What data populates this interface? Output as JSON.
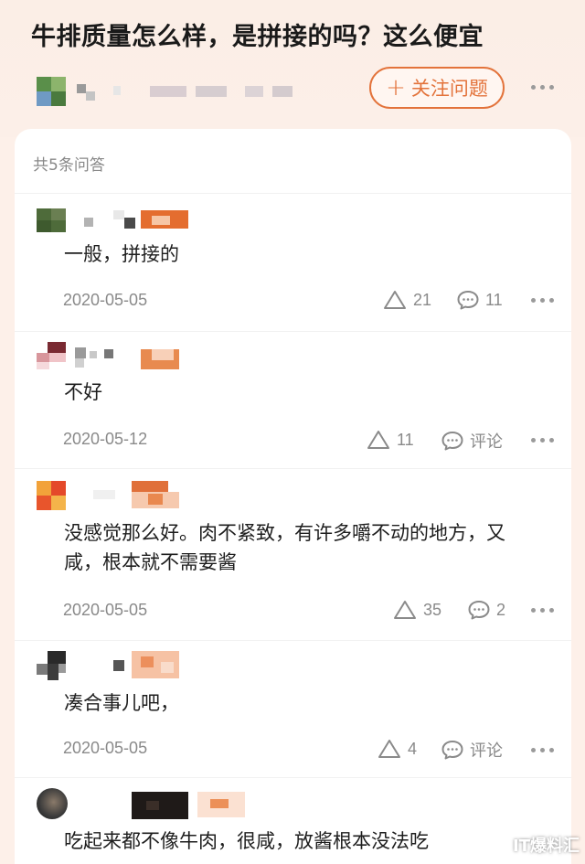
{
  "question": {
    "title": "牛排质量怎么样，是拼接的吗？这么便宜",
    "follow_label": "关注问题",
    "follow_icon": "plus-icon"
  },
  "answers_header": "共5条问答",
  "answers": [
    {
      "text": "一般，拼接的",
      "date": "2020-05-05",
      "likes": "21",
      "comments": "11"
    },
    {
      "text": "不好",
      "date": "2020-05-12",
      "likes": "11",
      "comments": "评论"
    },
    {
      "text": "没感觉那么好。肉不紧致，有许多嚼不动的地方，又咸，根本就不需要酱",
      "date": "2020-05-05",
      "likes": "35",
      "comments": "2"
    },
    {
      "text": "凑合事儿吧，",
      "date": "2020-05-05",
      "likes": "4",
      "comments": "评论"
    },
    {
      "text": "吃起来都不像牛肉，很咸，放酱根本没法吃"
    }
  ],
  "watermark": "IT爆料汇",
  "colors": {
    "accent": "#e3733b",
    "header_bg": "#fbeee6"
  }
}
